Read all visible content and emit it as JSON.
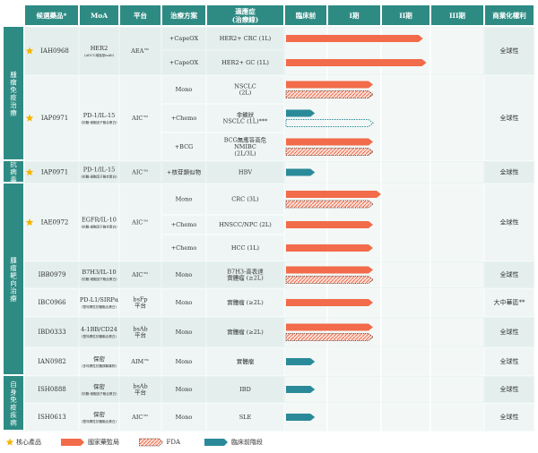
{
  "colors": {
    "header": "#2e8b84",
    "category_bg": "#2e8b84",
    "row_a": "#eaf3f2",
    "row_b": "#ffffff",
    "grid": "#ffffff",
    "national_approval": "#f26b4a",
    "fda": "#f26b4a",
    "preclinical": "#2b8a99",
    "star": "#f5b400"
  },
  "header": [
    "候選藥品*",
    "MoA",
    "平台",
    "治療方案",
    "適應症\n(治療線)",
    "臨床前",
    "I期",
    "II期",
    "III期",
    "商業化權利"
  ],
  "categories": [
    {
      "label": "腫瘤免疫治療",
      "rows": [
        0,
        5
      ]
    },
    {
      "label": "抗病毒",
      "rows": [
        6,
        6
      ]
    },
    {
      "label": "腫瘤靶向治療",
      "rows": [
        7,
        14
      ]
    },
    {
      "label": "自身免疫疾病",
      "rows": [
        15,
        16
      ]
    }
  ],
  "chart_data": {
    "type": "table",
    "stages": [
      "臨床前",
      "I期",
      "II期",
      "III期"
    ],
    "rows": [
      {
        "drug": "IAH0968",
        "star": true,
        "moa": "HER2",
        "moa_sub": "(ADCC增強型mAb)",
        "platform": "AEA™",
        "regimen": "+CapeOX",
        "indication": "HER2+ CRC (1L)",
        "bars": [
          {
            "type": "national",
            "stage": 2.85
          }
        ],
        "rights": "全球性"
      },
      {
        "drug": "",
        "star": false,
        "moa": "",
        "moa_sub": "",
        "platform": "",
        "regimen": "+CapeOX",
        "indication": "HER2+ GC (1L)",
        "bars": [
          {
            "type": "national",
            "stage": 2.92
          }
        ],
        "rights": ""
      },
      {
        "drug": "IAP0971",
        "star": true,
        "moa": "PD-1/IL-15",
        "moa_sub": "(抗體-細胞因子融合蛋白)",
        "platform": "AIC™",
        "regimen": "Mono",
        "indication": "NSCLC\n(2L)",
        "bars": [
          {
            "type": "national",
            "stage": 1.85
          },
          {
            "type": "fda",
            "stage": 1.85
          }
        ],
        "rights": "全球性"
      },
      {
        "drug": "",
        "star": false,
        "moa": "",
        "moa_sub": "",
        "platform": "",
        "regimen": "+Chemo",
        "indication": "非鱗狀\nNSCLC (1L)***",
        "bars": [
          {
            "type": "preclinical",
            "stage": 0.7
          },
          {
            "type": "planned",
            "stage": 1.85
          }
        ],
        "rights": ""
      },
      {
        "drug": "",
        "star": false,
        "moa": "",
        "moa_sub": "",
        "platform": "",
        "regimen": "+BCG",
        "indication": "BCG無應答高危\nNMIBC\n(2L/3L)",
        "bars": [
          {
            "type": "national",
            "stage": 1.85
          },
          {
            "type": "fda",
            "stage": 1.85
          }
        ],
        "rights": ""
      },
      {
        "drug": "",
        "star": false,
        "moa": "",
        "moa_sub": "",
        "platform": "",
        "regimen": "",
        "indication": "",
        "bars": [],
        "rights": ""
      },
      {
        "drug": "IAP0971",
        "star": true,
        "moa": "PD-1/IL-15",
        "moa_sub": "(抗體-細胞因子融合蛋白)",
        "platform": "AIC™",
        "regimen": "+核苷類似物",
        "indication": "HBV",
        "bars": [
          {
            "type": "preclinical",
            "stage": 0.7
          }
        ],
        "rights": "全球性"
      },
      {
        "drug": "IAE0972",
        "star": true,
        "moa": "EGFR/IL-10",
        "moa_sub": "(抗體-細胞因子融合蛋白)",
        "platform": "AIC™",
        "regimen": "Mono",
        "indication": "CRC (3L)",
        "bars": [
          {
            "type": "national",
            "stage": 2.0
          },
          {
            "type": "fda",
            "stage": 1.85
          }
        ],
        "rights": "全球性"
      },
      {
        "drug": "",
        "star": false,
        "moa": "",
        "moa_sub": "",
        "platform": "",
        "regimen": "+Chemo",
        "indication": "HNSCC/NPC (2L)",
        "bars": [
          {
            "type": "national",
            "stage": 1.85
          }
        ],
        "rights": ""
      },
      {
        "drug": "",
        "star": false,
        "moa": "",
        "moa_sub": "",
        "platform": "",
        "regimen": "+Chemo",
        "indication": "HCC (1L)",
        "bars": [
          {
            "type": "national",
            "stage": 1.85
          }
        ],
        "rights": ""
      },
      {
        "drug": "IBB0979",
        "star": false,
        "moa": "B7H3/IL-10",
        "moa_sub": "(抗體-細胞因子融合蛋白)",
        "platform": "AIC™",
        "regimen": "Mono",
        "indication": "B7H3-高表達\n實體瘤 (≥2L)",
        "bars": [
          {
            "type": "national",
            "stage": 1.85
          },
          {
            "type": "fda",
            "stage": 1.85
          }
        ],
        "rights": "全球性"
      },
      {
        "drug": "IBC0966",
        "star": false,
        "moa": "PD-L1/SIRPα",
        "moa_sub": "(雙特異性抗體融合蛋白)",
        "platform": "bsFp\n平台",
        "regimen": "Mono",
        "indication": "實體瘤 (≥2L)",
        "bars": [
          {
            "type": "national",
            "stage": 1.85
          }
        ],
        "rights": "大中華區**"
      },
      {
        "drug": "IBD0333",
        "star": false,
        "moa": "4-1BB/CD24",
        "moa_sub": "(雙特異性抗體融合蛋白)",
        "platform": "bsAb\n平台",
        "regimen": "Mono",
        "indication": "實體瘤 (≥2L)",
        "bars": [
          {
            "type": "national",
            "stage": 1.85
          },
          {
            "type": "fda",
            "stage": 1.85
          }
        ],
        "rights": "全球性"
      },
      {
        "drug": "IAN0982",
        "star": false,
        "moa": "保密",
        "moa_sub": "(多特異性抗體偶聯藥物)",
        "platform": "AIM™",
        "regimen": "Mono",
        "indication": "實體瘤",
        "bars": [
          {
            "type": "preclinical",
            "stage": 0.7
          }
        ],
        "rights": "全球性"
      },
      {
        "drug": "",
        "star": false,
        "moa": "",
        "moa_sub": "",
        "platform": "",
        "regimen": "",
        "indication": "",
        "bars": [],
        "rights": ""
      },
      {
        "drug": "ISH0888",
        "star": false,
        "moa": "保密",
        "moa_sub": "(抗體-細胞因子融合蛋白)",
        "platform": "bsAb\n平台",
        "regimen": "Mono",
        "indication": "IBD",
        "bars": [
          {
            "type": "preclinical",
            "stage": 0.7
          }
        ],
        "rights": "全球性"
      },
      {
        "drug": "ISH0613",
        "star": false,
        "moa": "保密",
        "moa_sub": "(雙特異性抗體融合蛋白)",
        "platform": "AIC™",
        "regimen": "Mono",
        "indication": "SLE",
        "bars": [
          {
            "type": "preclinical",
            "stage": 0.7
          }
        ],
        "rights": "全球性"
      }
    ],
    "legend": [
      {
        "type": "star",
        "label": "核心產品"
      },
      {
        "type": "national",
        "label": "國家藥監局"
      },
      {
        "type": "fda",
        "label": "FDA"
      },
      {
        "type": "preclinical",
        "label": "臨床前階段"
      }
    ],
    "legend_position": "bottom"
  }
}
